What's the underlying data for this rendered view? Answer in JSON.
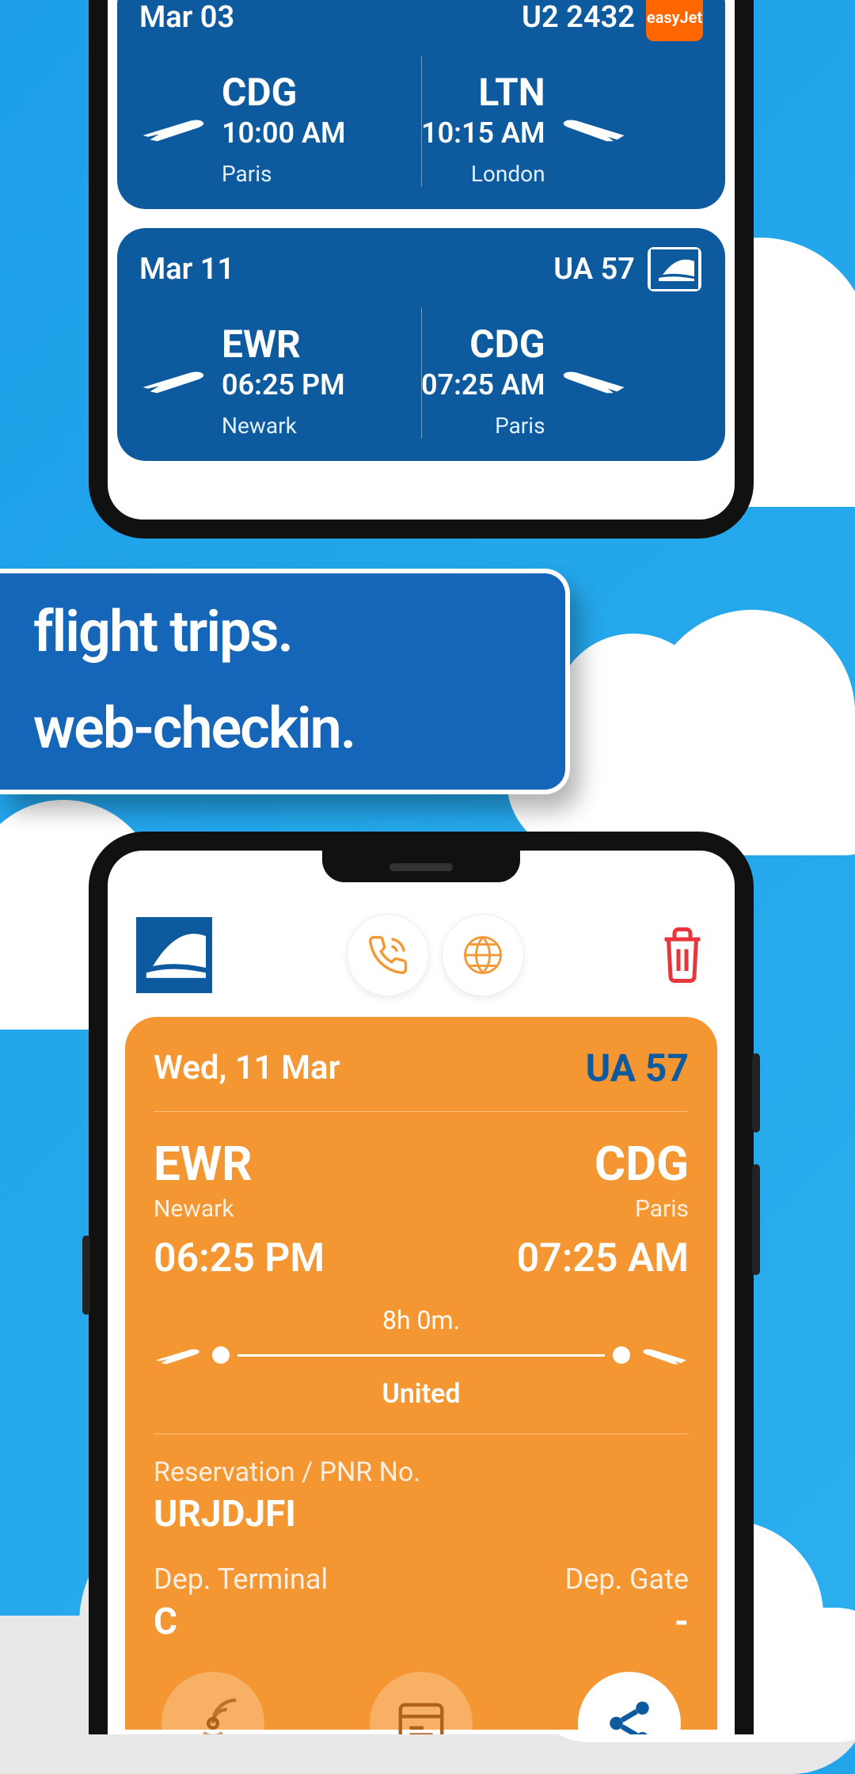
{
  "phone1": {
    "card1": {
      "date": "Mar 03",
      "flightno": "U2 2432",
      "airline": "easyJet",
      "dep": {
        "airport": "CDG",
        "time": "10:00 AM",
        "city": "Paris"
      },
      "arr": {
        "airport": "LTN",
        "time": "10:15 AM",
        "city": "London"
      }
    },
    "card2": {
      "date": "Mar 11",
      "flightno": "UA 57",
      "dep": {
        "airport": "EWR",
        "time": "06:25 PM",
        "city": "Newark"
      },
      "arr": {
        "airport": "CDG",
        "time": "07:25 AM",
        "city": "Paris"
      }
    }
  },
  "overlay": {
    "line1": "flight trips.",
    "line2": "web-checkin."
  },
  "ticket": {
    "date": "Wed, 11 Mar",
    "flightno": "UA 57",
    "dep": {
      "airport": "EWR",
      "city": "Newark",
      "time": "06:25 PM"
    },
    "arr": {
      "airport": "CDG",
      "city": "Paris",
      "time": "07:25 AM"
    },
    "duration": "8h 0m.",
    "airline": "United",
    "pnr_label": "Reservation / PNR No.",
    "pnr": "URJDJFI",
    "terminal_label": "Dep. Terminal",
    "terminal": "C",
    "gate_label": "Dep. Gate",
    "gate": "-"
  }
}
